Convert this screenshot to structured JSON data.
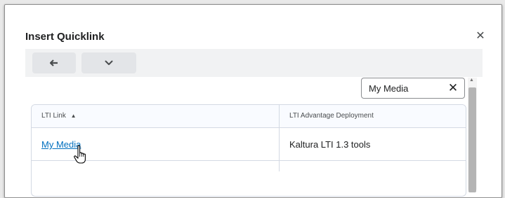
{
  "dialog": {
    "title": "Insert Quicklink",
    "close_icon": "close-icon"
  },
  "toolbar": {
    "back_icon": "arrow-left-icon",
    "dropdown_icon": "chevron-down-icon"
  },
  "search": {
    "value": "My Media",
    "clear_icon": "close-icon"
  },
  "table": {
    "columns": [
      {
        "label": "LTI Link",
        "sort": "ascending"
      },
      {
        "label": "LTI Advantage Deployment"
      }
    ],
    "rows": [
      {
        "link": "My Media",
        "deployment": "Kaltura LTI 1.3 tools"
      }
    ]
  },
  "colors": {
    "link": "#006fbf",
    "header_bg": "#f9fbff",
    "toolbar_bg": "#f1f2f3",
    "button_bg": "#e3e5e8"
  }
}
